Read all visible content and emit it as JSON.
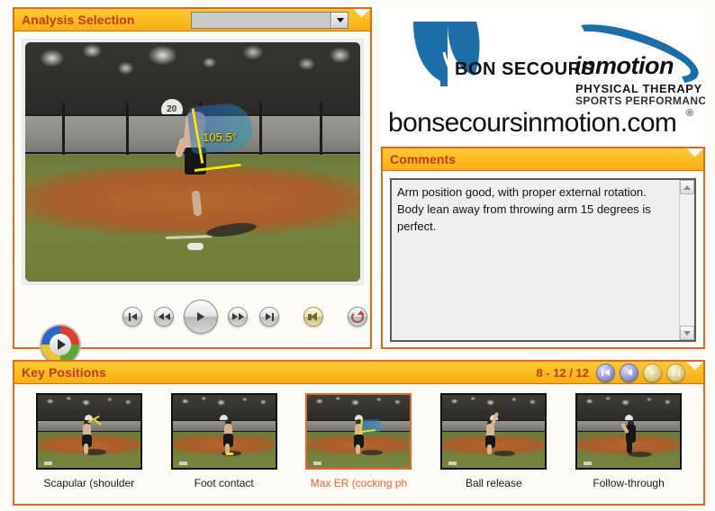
{
  "app": {
    "background_color": "#fdfbf5",
    "accent_color": "#e06820",
    "header_gradient_from": "#fcc835",
    "header_gradient_to": "#f9ae10",
    "title_color": "#c03a12",
    "selected_color": "#f0622a"
  },
  "analysis": {
    "title": "Analysis Selection",
    "dropdown": {
      "value": "",
      "placeholder": "",
      "caret_icon": "chevron-down-icon"
    },
    "video": {
      "angle_label": "105.5°",
      "sign_text": "20",
      "overlay_color": "#ffe400"
    },
    "controls": {
      "wmp_logo": "media-player-logo",
      "skip_back": "skip-to-start-icon",
      "rewind": "rewind-icon",
      "play": "play-icon",
      "fast_forward": "fast-forward-icon",
      "skip_forward": "skip-to-end-icon",
      "volume": "volume-icon",
      "loop": "loop-icon"
    }
  },
  "logo": {
    "brand": "BON SECOURS",
    "brand_in": "in",
    "brand_motion": "motion",
    "tagline1": "PHYSICAL THERAPY",
    "tagline2": "SPORTS PERFORMANCE",
    "url": "bonsecoursinmotion.com",
    "trademark": "®",
    "color": "#1b6ea8"
  },
  "comments": {
    "title": "Comments",
    "text": "Arm position good, with proper external rotation.  Body lean away from throwing arm 15 degrees is perfect.",
    "scroll_up_icon": "scroll-up-icon",
    "scroll_down_icon": "scroll-down-icon"
  },
  "key_positions": {
    "title": "Key Positions",
    "counter": "8 - 12  /  12",
    "nav": [
      {
        "name": "first-page-button",
        "icon": "skip-to-start-icon",
        "state": "active"
      },
      {
        "name": "previous-page-button",
        "icon": "previous-icon",
        "state": "active"
      },
      {
        "name": "next-page-button",
        "icon": "next-icon",
        "state": "disabled"
      },
      {
        "name": "last-page-button",
        "icon": "skip-to-end-icon",
        "state": "disabled"
      }
    ],
    "items": [
      {
        "label": "Scapular (shoulder",
        "selected": false
      },
      {
        "label": "Foot contact",
        "selected": false
      },
      {
        "label": "Max ER (cocking ph",
        "selected": true
      },
      {
        "label": "Ball release",
        "selected": false
      },
      {
        "label": "Follow-through",
        "selected": false
      }
    ]
  }
}
